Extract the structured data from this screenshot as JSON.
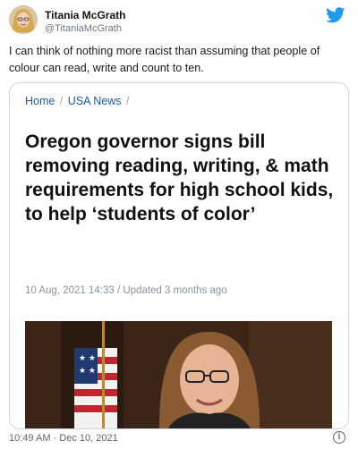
{
  "tweet": {
    "display_name": "Titania McGrath",
    "handle": "@TitaniaMcGrath",
    "text": "I can think of nothing more racist than assuming that people of colour can read, write and count to ten.",
    "timestamp": "10:49 AM · Dec 10, 2021",
    "brand_color": "#1d9bf0"
  },
  "card": {
    "breadcrumbs": [
      "Home",
      "USA News"
    ],
    "headline": "Oregon governor signs bill removing reading, writing, & math requirements for high school kids, to help ‘students of color’",
    "meta": "10 Aug, 2021 14:33 / Updated 3 months ago",
    "link_color": "#1a5aa8"
  },
  "icons": {
    "brand": "twitter-bird-icon",
    "info": "info-icon"
  }
}
